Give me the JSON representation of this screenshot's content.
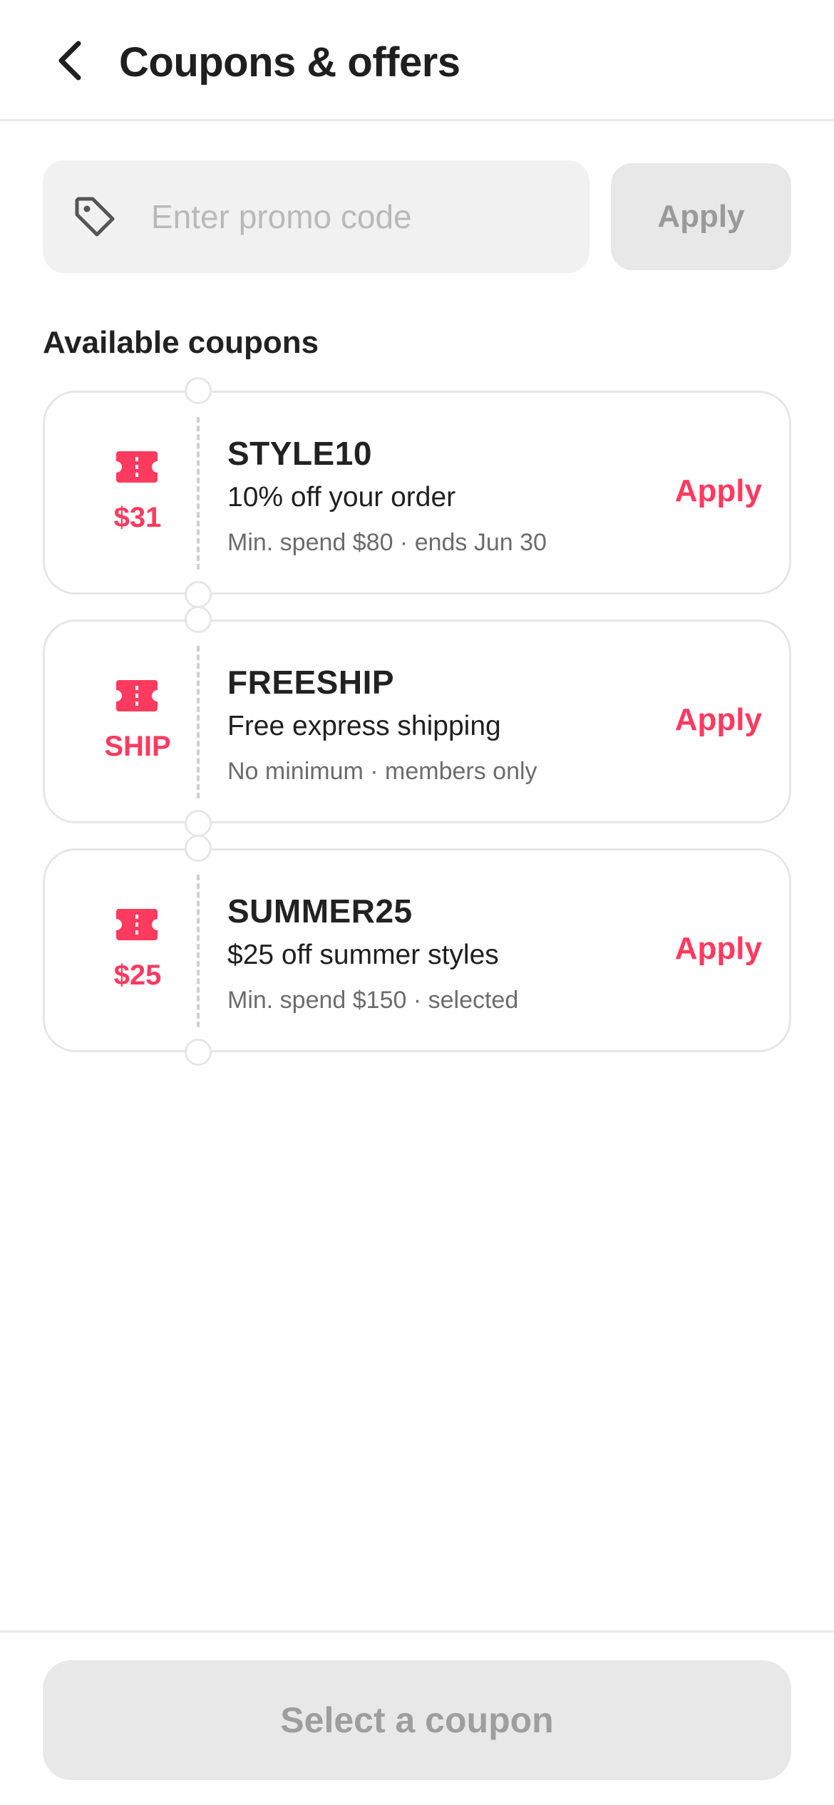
{
  "header": {
    "title": "Coupons & offers",
    "back_icon": "chevron-left-icon"
  },
  "promo": {
    "placeholder": "Enter promo code",
    "value": "",
    "icon": "tag-icon",
    "apply_label": "Apply"
  },
  "section": {
    "title": "Available coupons"
  },
  "coupons": [
    {
      "badge": "$31",
      "code": "STYLE10",
      "description": "10% off your order",
      "meta": "Min. spend $80 · ends Jun 30",
      "action": "Apply"
    },
    {
      "badge": "SHIP",
      "code": "FREESHIP",
      "description": "Free express shipping",
      "meta": "No minimum · members only",
      "action": "Apply"
    },
    {
      "badge": "$25",
      "code": "SUMMER25",
      "description": "$25 off summer styles",
      "meta": "Min. spend $150 · selected",
      "action": "Apply"
    }
  ],
  "footer": {
    "button_label": "Select a coupon"
  },
  "colors": {
    "accent": "#ff3a5f",
    "disabled_bg": "#e8e8e8",
    "disabled_text": "#9e9e9e",
    "input_bg": "#f1f1f1"
  }
}
